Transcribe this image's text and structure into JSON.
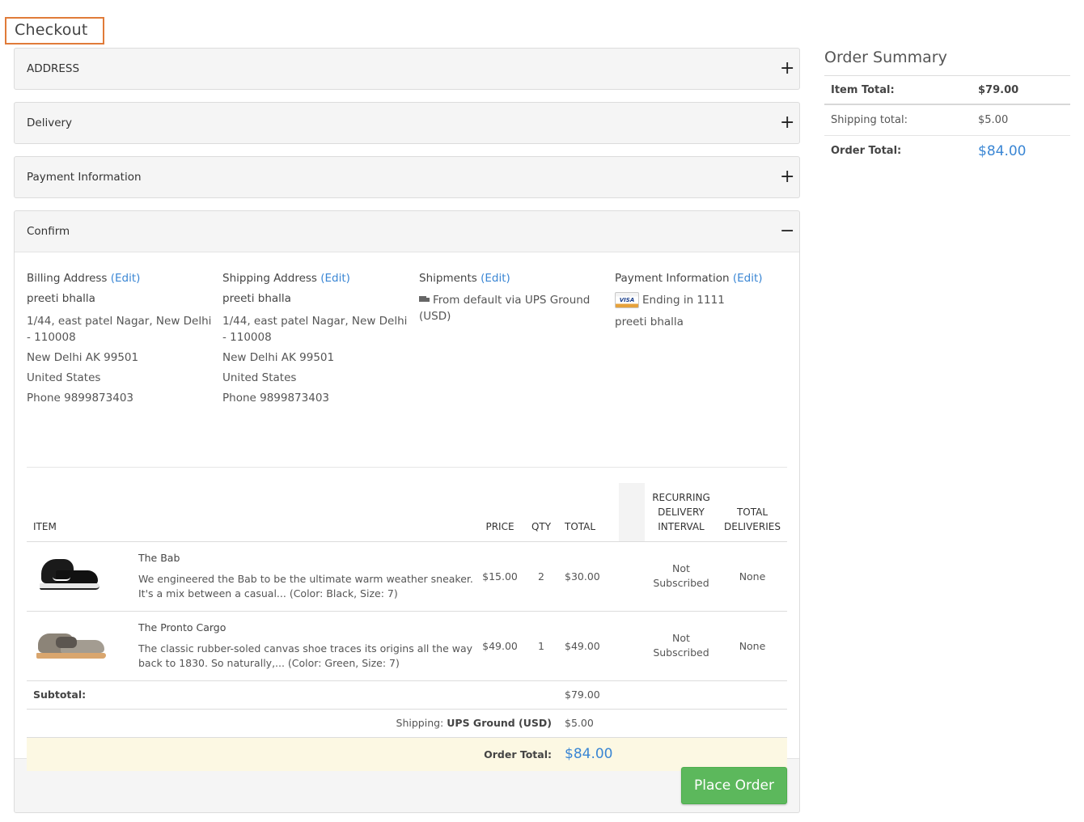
{
  "page": {
    "title": "Checkout"
  },
  "sections": {
    "address": {
      "label": "ADDRESS",
      "toggle": "+"
    },
    "delivery": {
      "label": "Delivery",
      "toggle": "+"
    },
    "payment": {
      "label": "Payment Information",
      "toggle": "+"
    },
    "confirm": {
      "label": "Confirm",
      "toggle": "−"
    }
  },
  "confirm": {
    "billing": {
      "heading": "Billing Address",
      "edit": "(Edit)",
      "name": "preeti bhalla",
      "line1": "1/44, east patel Nagar, New Delhi - 110008",
      "line2": "New Delhi AK 99501",
      "country": "United States",
      "phone": "Phone 9899873403"
    },
    "shipping": {
      "heading": "Shipping Address",
      "edit": "(Edit)",
      "name": "preeti bhalla",
      "line1": "1/44, east patel Nagar, New Delhi - 110008",
      "line2": "New Delhi AK 99501",
      "country": "United States",
      "phone": "Phone 9899873403"
    },
    "shipments": {
      "heading": "Shipments",
      "edit": "(Edit)",
      "text": "From default via UPS Ground (USD)",
      "icon": "truck-icon"
    },
    "payment": {
      "heading": "Payment Information",
      "edit": "(Edit)",
      "card_icon": "visa-card-icon",
      "card_brand": "VISA",
      "card_text": "Ending in 1111",
      "name": "preeti bhalla"
    },
    "table": {
      "headers": {
        "item": "ITEM",
        "price": "PRICE",
        "qty": "QTY",
        "total": "TOTAL",
        "recurring": "RECURRING DELIVERY INTERVAL",
        "deliveries": "TOTAL DELIVERIES"
      },
      "rows": [
        {
          "name": "The Bab",
          "description": "We engineered the Bab to be the ultimate warm weather sneaker. It's a mix between a casual... (Color: Black, Size: 7)",
          "price": "$15.00",
          "qty": "2",
          "total": "$30.00",
          "recurring": "Not Subscribed",
          "deliveries": "None"
        },
        {
          "name": "The Pronto Cargo",
          "description": "The classic rubber-soled canvas shoe traces its origins all the way back to 1830. So naturally,... (Color: Green, Size: 7)",
          "price": "$49.00",
          "qty": "1",
          "total": "$49.00",
          "recurring": "Not Subscribed",
          "deliveries": "None"
        }
      ],
      "subtotal_label": "Subtotal:",
      "subtotal_value": "$79.00",
      "shipping_prefix": "Shipping:",
      "shipping_method": "UPS Ground (USD)",
      "shipping_value": "$5.00",
      "order_total_label": "Order Total:",
      "order_total_value": "$84.00"
    },
    "place_order": "Place Order"
  },
  "summary": {
    "title": "Order Summary",
    "item_total_label": "Item Total:",
    "item_total_value": "$79.00",
    "shipping_label": "Shipping total:",
    "shipping_value": "$5.00",
    "order_total_label": "Order Total:",
    "order_total_value": "$84.00"
  },
  "colors": {
    "accent_blue": "#3a86d4",
    "title_border": "#e07b39",
    "place_order_green": "#5cb85c",
    "order_total_row": "#fcf8e3"
  }
}
